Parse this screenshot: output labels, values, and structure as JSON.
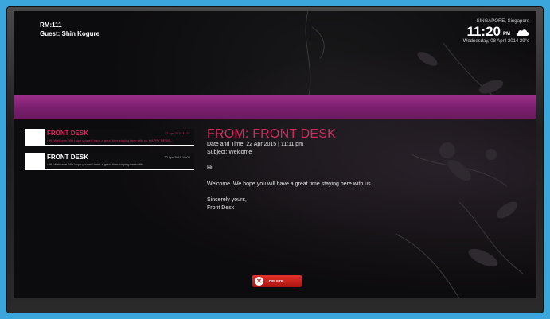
{
  "room": {
    "room_label": "RM:111",
    "guest_label": "Guest: Shin Kogure"
  },
  "weather": {
    "city": "SINGAPORE, Singapore",
    "time": "11:20",
    "ampm": "PM",
    "date": "Wednesday, 08 April 2014 29°c",
    "icon": "cloud-icon"
  },
  "messages": [
    {
      "title": "FRONT DESK",
      "date": "22 Apr 2015 11:11",
      "preview": "• Hi, Welcome. We hope you will have a great time staying here with us. HAPPY NEWS...",
      "active": true
    },
    {
      "title": "FRONT DESK",
      "date": "22 Apr 2015 10:00",
      "preview": "• Hi, Welcome. We hope you will have a great time staying here with...",
      "active": false
    }
  ],
  "detail": {
    "from": "FROM: FRONT DESK",
    "datetime": "Date and Time: 22 Apr 2015 | 11:11 pm",
    "subject": "Subject: Welcome",
    "greeting": "Hi,",
    "body": "Welcome. We hope you will have a great time staying here with us.",
    "closing": "Sincerely yours,",
    "signature": "Front Desk"
  },
  "actions": {
    "delete_label": "DELETE"
  },
  "colors": {
    "accent": "#d02b5e",
    "band": "#8a2679",
    "background": "#3aa6dc"
  }
}
